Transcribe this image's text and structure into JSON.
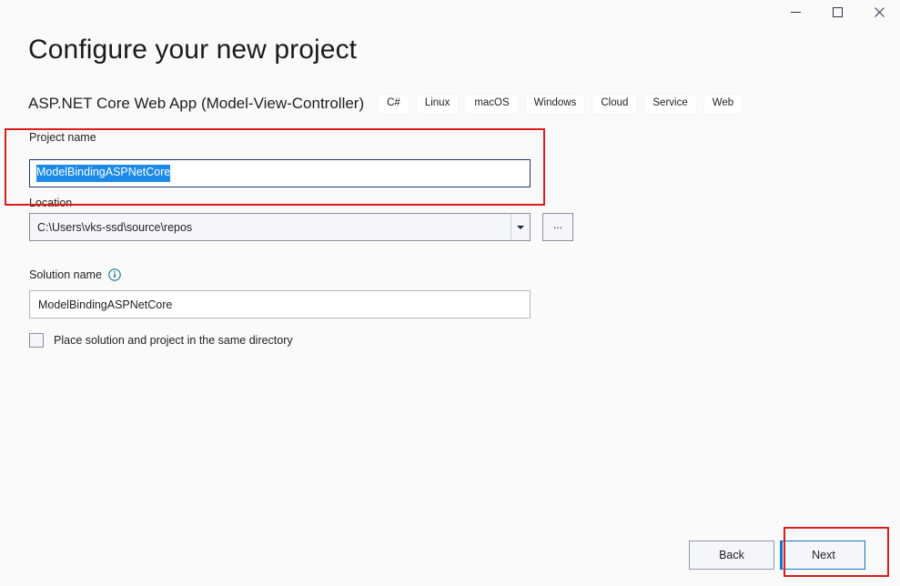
{
  "window": {
    "controls": [
      {
        "name": "minimize",
        "icon": "minimize-icon",
        "label": "Minimize"
      },
      {
        "name": "maximize",
        "icon": "maximize-icon",
        "label": "Maximize"
      },
      {
        "name": "close",
        "icon": "close-icon",
        "label": "Close"
      }
    ]
  },
  "header": {
    "title": "Configure your new project",
    "template_name": "ASP.NET Core Web App (Model-View-Controller)",
    "tags": [
      "C#",
      "Linux",
      "macOS",
      "Windows",
      "Cloud",
      "Service",
      "Web"
    ]
  },
  "form": {
    "project_name": {
      "label": "Project name",
      "value": "ModelBindingASPNetCore",
      "selected": true,
      "selection_color": "#1c8ae8",
      "focus_border_color": "#1b3a6b"
    },
    "location": {
      "label": "Location",
      "value": "C:\\Users\\vks-ssd\\source\\repos",
      "dropdown_icon": "chevron-down-icon",
      "browse_label": "...",
      "browse_icon": "ellipsis-icon"
    },
    "solution_name": {
      "label": "Solution name",
      "info_icon": "info-icon",
      "value": "ModelBindingASPNetCore"
    },
    "same_directory": {
      "label": "Place solution and project in the same directory",
      "checked": false
    }
  },
  "footer": {
    "back_label": "Back",
    "next_label": "Next",
    "next_focused": true,
    "next_accent_color": "#1177c2"
  },
  "annotations": {
    "color": "#e01b1b",
    "regions": [
      "project-name-field",
      "next-button"
    ]
  }
}
